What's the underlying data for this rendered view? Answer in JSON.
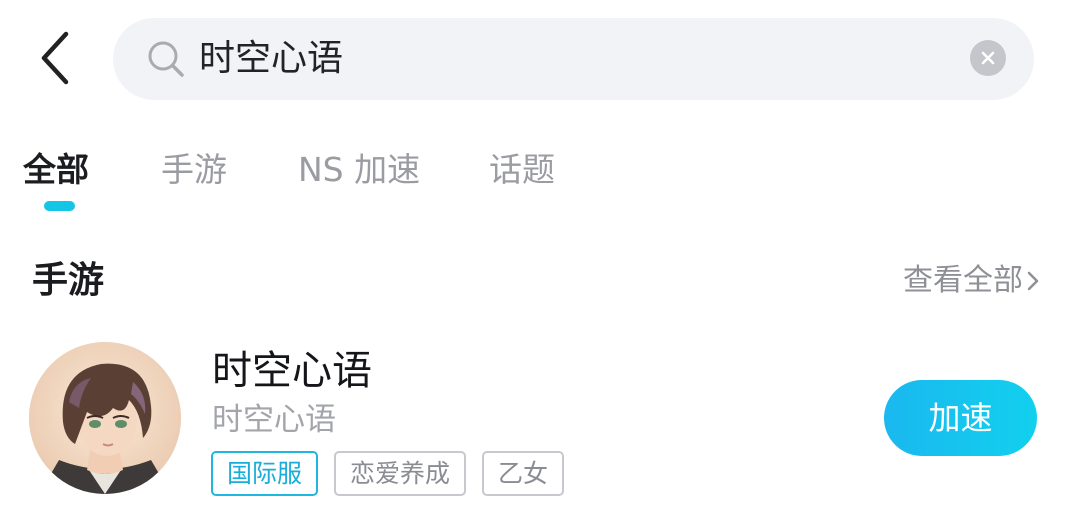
{
  "header": {
    "back_icon": "chevron-left-icon",
    "search": {
      "icon": "search-icon",
      "value": "时空心语",
      "clear_icon": "clear-icon"
    }
  },
  "tabs": [
    {
      "label": "全部",
      "active": true
    },
    {
      "label": "手游",
      "active": false
    },
    {
      "label": "NS 加速",
      "active": false
    },
    {
      "label": "话题",
      "active": false
    }
  ],
  "section": {
    "title": "手游",
    "see_all": "查看全部"
  },
  "game": {
    "name": "时空心语",
    "subtitle": "时空心语",
    "tags": [
      {
        "label": "国际服",
        "highlight": true
      },
      {
        "label": "恋爱养成",
        "highlight": false
      },
      {
        "label": "乙女",
        "highlight": false
      }
    ],
    "action_label": "加速"
  },
  "colors": {
    "accent": "#15c5e6",
    "search_bg": "#f1f3f6",
    "tag_highlight": "#1fb6e0"
  }
}
